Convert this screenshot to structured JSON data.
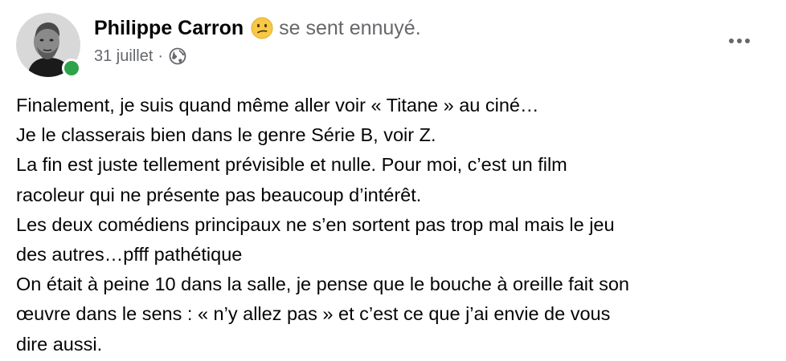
{
  "post": {
    "author": "Philippe Carron",
    "feeling_text": "se sent ennuyé.",
    "date": "31 juillet",
    "separator": "·",
    "audience_icon": "globe-icon",
    "feeling_icon": "confused-face-emoji",
    "more_icon": "more-options-icon",
    "online_color": "#31a24c",
    "body_lines": [
      "Finalement, je suis quand même aller voir « Titane » au ciné…",
      "Je le classerais bien dans le genre Série B, voir Z.",
      "La fin est juste tellement prévisible et nulle. Pour moi, c’est un film",
      "racoleur qui ne présente pas beaucoup d’intérêt.",
      "Les deux comédiens principaux ne s’en sortent pas trop mal mais le jeu",
      "des autres…pfff pathétique",
      "On était à peine 10 dans la salle, je pense que le bouche à oreille fait son",
      "œuvre dans le sens : « n’y allez pas » et c’est ce que j’ai envie de vous",
      "dire aussi."
    ]
  }
}
